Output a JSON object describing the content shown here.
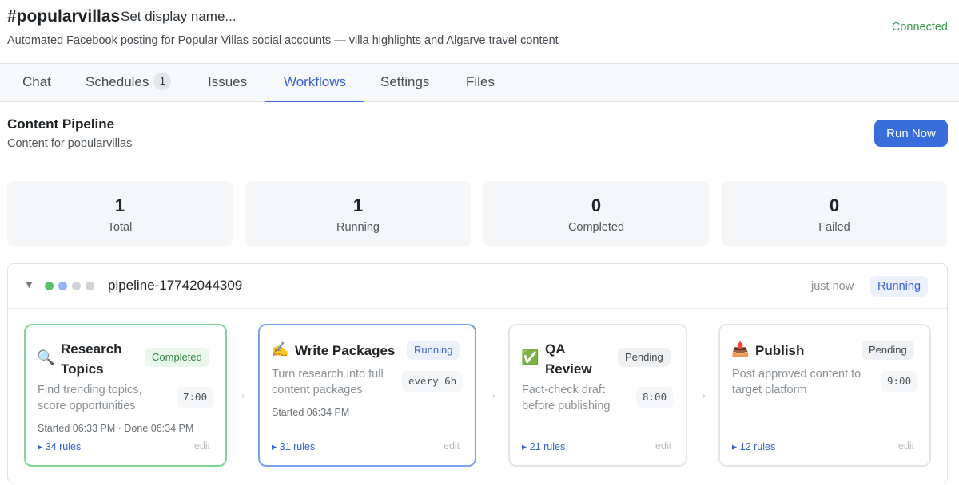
{
  "channel": {
    "name": "#popularvillas",
    "display_name_prompt": "Set display name...",
    "description": "Automated Facebook posting for Popular Villas social accounts — villa highlights and Algarve travel content",
    "status": "Connected"
  },
  "tabs": [
    {
      "label": "Chat"
    },
    {
      "label": "Schedules",
      "badge": "1"
    },
    {
      "label": "Issues"
    },
    {
      "label": "Workflows",
      "active": true
    },
    {
      "label": "Settings"
    },
    {
      "label": "Files"
    }
  ],
  "workflow": {
    "title": "Content Pipeline",
    "subtitle": "Content for popularvillas",
    "run_button": "Run Now"
  },
  "stats": [
    {
      "value": "1",
      "label": "Total"
    },
    {
      "value": "1",
      "label": "Running"
    },
    {
      "value": "0",
      "label": "Completed"
    },
    {
      "value": "0",
      "label": "Failed"
    }
  ],
  "run": {
    "toggle_icon": "▼",
    "id": "pipeline-17742044309",
    "time": "just now",
    "status": "Running",
    "progress_dot_colors": [
      "#57c46a",
      "#93b4f2",
      "#cfd2d7",
      "#cfd2d7"
    ],
    "stages": [
      {
        "icon": "🔍",
        "icon_name": "magnifier-icon",
        "name_lines": [
          "Research",
          "Topics"
        ],
        "status": "Completed",
        "description_lines": [
          "Find trending topics,",
          "score opportunities"
        ],
        "schedule": "7:00",
        "meta": "Started 06:33 PM · Done 06:34 PM",
        "rules": "▸ 34 rules",
        "edit": "edit"
      },
      {
        "icon": "✍️",
        "icon_name": "writing-hand-icon",
        "name_lines": [
          "Write Packages"
        ],
        "status": "Running",
        "description_lines": [
          "Turn research into full",
          "content packages"
        ],
        "schedule": "every 6h",
        "meta": "Started 06:34 PM",
        "rules": "▸ 31 rules",
        "edit": "edit"
      },
      {
        "icon": "✅",
        "icon_name": "check-box-icon",
        "name_lines": [
          "QA",
          "Review"
        ],
        "status": "Pending",
        "description_lines": [
          "Fact-check draft",
          "before publishing"
        ],
        "schedule": "8:00",
        "rules": "▸ 21 rules",
        "edit": "edit"
      },
      {
        "icon": "📤",
        "icon_name": "outbox-tray-icon",
        "name_lines": [
          "Publish"
        ],
        "status": "Pending",
        "description_lines": [
          "Post approved content to",
          "target platform"
        ],
        "schedule": "9:00",
        "rules": "▸ 12 rules",
        "edit": "edit"
      }
    ],
    "connector": "→"
  }
}
